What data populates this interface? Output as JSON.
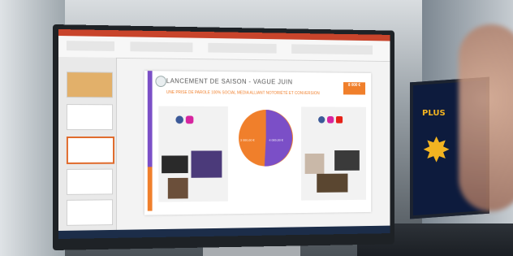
{
  "slide": {
    "title": "LANCEMENT DE SAISON - VAGUE JUIN",
    "subtitle": "UNE PRISE DE PAROLE 100% SOCIAL MEDIA ALLIANT NOTORIÉTÉ ET CONVERSION",
    "badge": "8 000 €",
    "pie_left_label": "3 000,00 €",
    "pie_right_label": "4 000,00 €"
  },
  "laptop": {
    "label": "PLUS",
    "star": "✸"
  },
  "colors": {
    "accent_orange": "#f07f2b",
    "accent_purple": "#7b4fc7",
    "ppt_red": "#c8442b",
    "taskbar": "#1c2d49"
  }
}
